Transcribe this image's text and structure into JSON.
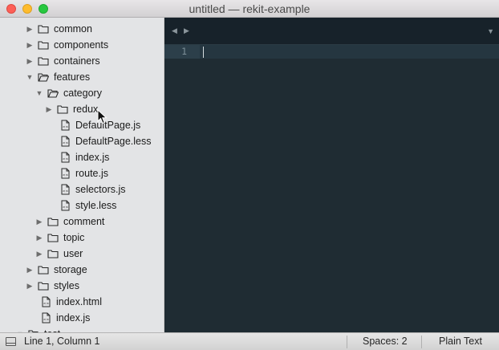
{
  "window": {
    "title": "untitled — rekit-example"
  },
  "sidebar": {
    "rows": [
      {
        "label": "common",
        "type": "folder",
        "expanded": false,
        "depth": 0
      },
      {
        "label": "components",
        "type": "folder",
        "expanded": false,
        "depth": 0
      },
      {
        "label": "containers",
        "type": "folder",
        "expanded": false,
        "depth": 0
      },
      {
        "label": "features",
        "type": "folder",
        "expanded": true,
        "depth": 0
      },
      {
        "label": "category",
        "type": "folder",
        "expanded": true,
        "depth": 1
      },
      {
        "label": "redux",
        "type": "folder",
        "expanded": false,
        "depth": 2
      },
      {
        "label": "DefaultPage.js",
        "type": "file",
        "depth": 2
      },
      {
        "label": "DefaultPage.less",
        "type": "file",
        "depth": 2
      },
      {
        "label": "index.js",
        "type": "file",
        "depth": 2
      },
      {
        "label": "route.js",
        "type": "file",
        "depth": 2
      },
      {
        "label": "selectors.js",
        "type": "file",
        "depth": 2
      },
      {
        "label": "style.less",
        "type": "file",
        "depth": 2
      },
      {
        "label": "comment",
        "type": "folder",
        "expanded": false,
        "depth": 1
      },
      {
        "label": "topic",
        "type": "folder",
        "expanded": false,
        "depth": 1
      },
      {
        "label": "user",
        "type": "folder",
        "expanded": false,
        "depth": 1
      },
      {
        "label": "storage",
        "type": "folder",
        "expanded": false,
        "depth": 0
      },
      {
        "label": "styles",
        "type": "folder",
        "expanded": false,
        "depth": 0
      },
      {
        "label": "index.html",
        "type": "file",
        "depth": 0
      },
      {
        "label": "index.js",
        "type": "file",
        "depth": 0
      },
      {
        "label": "test",
        "type": "folder",
        "expanded": true,
        "depth": -1
      }
    ]
  },
  "editor": {
    "line_number": "1",
    "content": ""
  },
  "statusbar": {
    "position": "Line 1, Column 1",
    "indentation": "Spaces: 2",
    "syntax": "Plain Text"
  },
  "colors": {
    "editor_bg": "#1f2c33",
    "sidebar_bg": "#e3e4e6",
    "active_line": "#253640"
  },
  "icons": {
    "folder": "folder-icon",
    "file": "file-icon",
    "collapsed": "triangle-right-icon",
    "expanded": "triangle-down-icon"
  }
}
